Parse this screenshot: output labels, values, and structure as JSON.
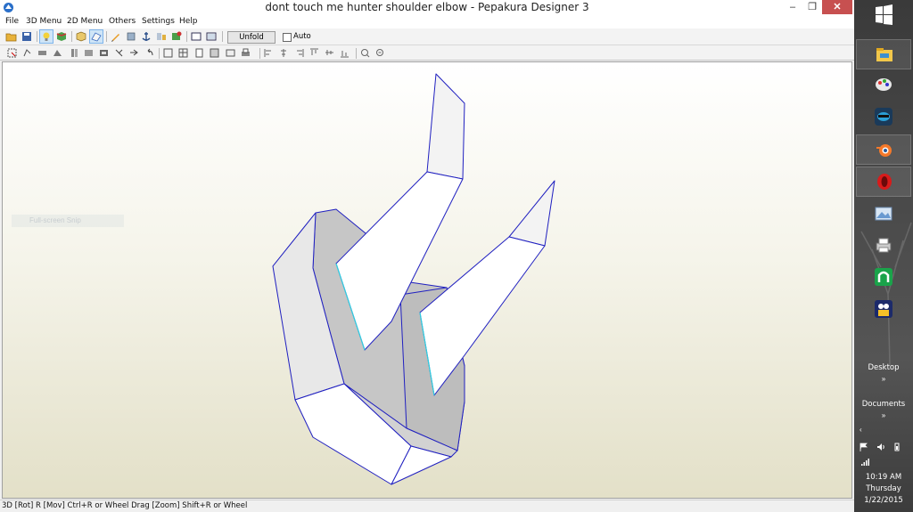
{
  "window": {
    "title": "dont touch me hunter shoulder elbow - Pepakura Designer 3",
    "min_glyph": "–",
    "restore_glyph": "❐",
    "close_glyph": "✕"
  },
  "menu": {
    "items": [
      "File",
      "3D Menu",
      "2D Menu",
      "Others",
      "Settings",
      "Help"
    ]
  },
  "toolbar": {
    "unfold_label": "Unfold",
    "auto_label": "Auto",
    "auto_checked": false
  },
  "viewport": {
    "ghost_text": "Full-screen Snip"
  },
  "status": {
    "text": "3D [Rot] R [Mov] Ctrl+R or Wheel Drag [Zoom] Shift+R or Wheel"
  },
  "taskbar": {
    "desktop_label": "Desktop",
    "documents_label": "Documents",
    "expand_glyph": "»",
    "collapse_glyph": "‹",
    "time": "10:19 AM",
    "day": "Thursday",
    "date": "1/22/2015",
    "apps": [
      "file-explorer",
      "paint",
      "masked-app",
      "blender",
      "opera",
      "photo-viewer",
      "printer",
      "green-app",
      "media-app"
    ]
  },
  "colors": {
    "edge": "#2020c0",
    "fold_edge": "#30d0e0",
    "close_red": "#c75050"
  }
}
